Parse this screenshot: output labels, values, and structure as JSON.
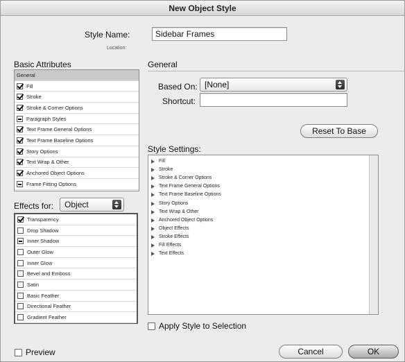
{
  "window": {
    "title": "New Object Style"
  },
  "style_name": {
    "label": "Style Name:",
    "value": "Sidebar Frames",
    "location_label": "Location:"
  },
  "basic_attributes": {
    "title": "Basic Attributes",
    "items": [
      {
        "label": "General",
        "state": "none",
        "selected": true
      },
      {
        "label": "Fill",
        "state": "checked"
      },
      {
        "label": "Stroke",
        "state": "checked"
      },
      {
        "label": "Stroke & Corner Options",
        "state": "checked"
      },
      {
        "label": "Paragraph Styles",
        "state": "mixed"
      },
      {
        "label": "Text Frame General Options",
        "state": "checked"
      },
      {
        "label": "Text Frame Baseline Options",
        "state": "checked"
      },
      {
        "label": "Story Options",
        "state": "checked"
      },
      {
        "label": "Text Wrap & Other",
        "state": "checked"
      },
      {
        "label": "Anchored Object Options",
        "state": "checked"
      },
      {
        "label": "Frame Fitting Options",
        "state": "mixed"
      }
    ]
  },
  "effects_for": {
    "label": "Effects for:",
    "value": "Object",
    "items": [
      {
        "label": "Transparency",
        "state": "checked"
      },
      {
        "label": "Drop Shadow",
        "state": "unchecked"
      },
      {
        "label": "Inner Shadow",
        "state": "mixed"
      },
      {
        "label": "Outer Glow",
        "state": "unchecked"
      },
      {
        "label": "Inner Glow",
        "state": "unchecked"
      },
      {
        "label": "Bevel and Emboss",
        "state": "unchecked"
      },
      {
        "label": "Satin",
        "state": "unchecked"
      },
      {
        "label": "Basic Feather",
        "state": "unchecked"
      },
      {
        "label": "Directional Feather",
        "state": "unchecked"
      },
      {
        "label": "Gradient Feather",
        "state": "unchecked"
      }
    ]
  },
  "general": {
    "title": "General",
    "based_on_label": "Based On:",
    "based_on_value": "[None]",
    "shortcut_label": "Shortcut:",
    "shortcut_value": "",
    "reset_label": "Reset To Base"
  },
  "style_settings": {
    "title": "Style Settings:",
    "items": [
      "Fill",
      "Stroke",
      "Stroke & Corner Options",
      "Text Frame General Options",
      "Text Frame Baseline Options",
      "Story Options",
      "Text Wrap & Other",
      "Anchored Object Options",
      "Object Effects",
      "Stroke Effects",
      "Fill Effects",
      "Text Effects"
    ]
  },
  "apply_style": {
    "label": "Apply Style to Selection",
    "checked": false
  },
  "preview": {
    "label": "Preview",
    "checked": false
  },
  "buttons": {
    "cancel": "Cancel",
    "ok": "OK"
  }
}
